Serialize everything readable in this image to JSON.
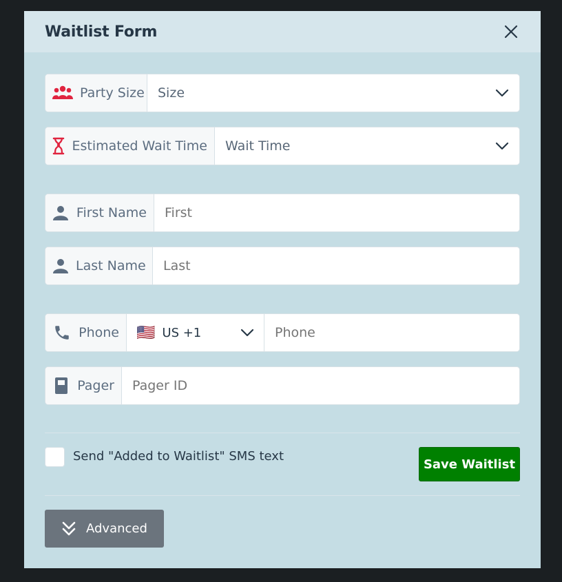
{
  "modal": {
    "title": "Waitlist Form"
  },
  "fields": {
    "party_size": {
      "label": "Party Size",
      "value": "Size",
      "icon": "group-icon"
    },
    "wait_time": {
      "label": "Estimated Wait Time",
      "value": "Wait Time",
      "icon": "hourglass-icon"
    },
    "first_name": {
      "label": "First Name",
      "placeholder": "First",
      "icon": "person-icon"
    },
    "last_name": {
      "label": "Last Name",
      "placeholder": "Last",
      "icon": "person-icon"
    },
    "phone": {
      "label": "Phone",
      "country": "US +1",
      "placeholder": "Phone",
      "icon": "phone-icon"
    },
    "pager": {
      "label": "Pager",
      "placeholder": "Pager ID",
      "icon": "pager-icon"
    }
  },
  "sms": {
    "label": "Send \"Added to Waitlist\" SMS text",
    "checked": false
  },
  "actions": {
    "save": "Save Waitlist",
    "advanced": "Advanced"
  },
  "colors": {
    "accent_red": "#e0243f",
    "save_green": "#008000",
    "panel": "#c5dde4",
    "header": "#d6e6ec"
  }
}
